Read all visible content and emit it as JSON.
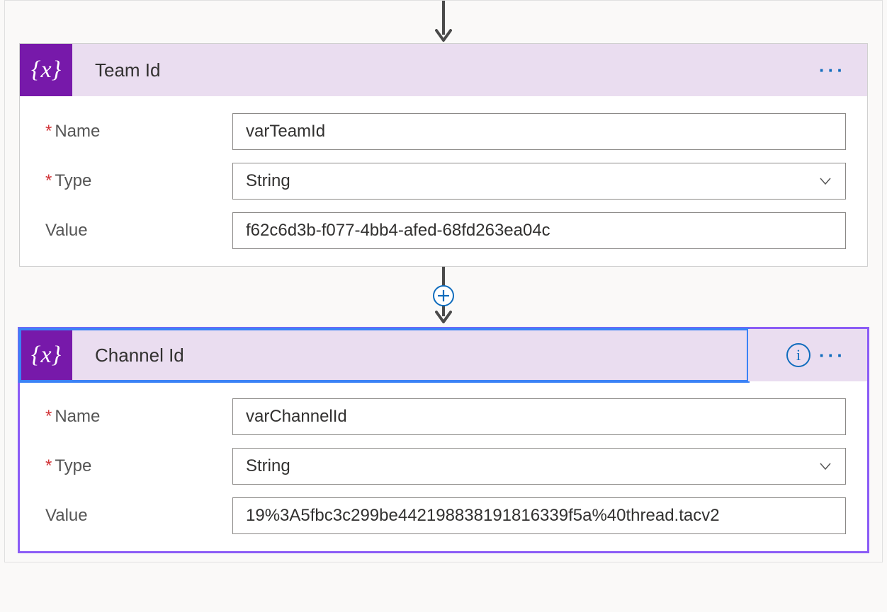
{
  "labels": {
    "name": "Name",
    "type": "Type",
    "value": "Value"
  },
  "cards": [
    {
      "title": "Team Id",
      "selected": false,
      "name": "varTeamId",
      "type": "String",
      "value": "f62c6d3b-f077-4bb4-afed-68fd263ea04c"
    },
    {
      "title": "Channel Id",
      "selected": true,
      "name": "varChannelId",
      "type": "String",
      "value": "19%3A5fbc3c299be442198838191816339f5a%40thread.tacv2"
    }
  ]
}
